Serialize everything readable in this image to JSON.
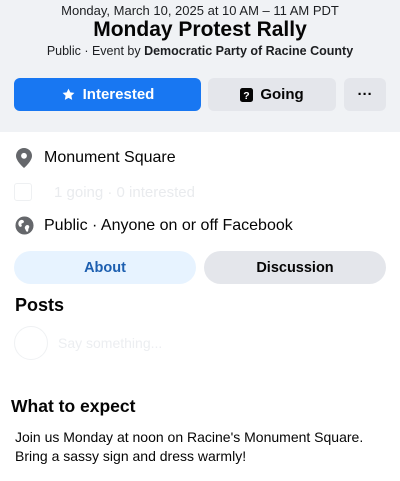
{
  "event": {
    "date_line": "Monday, March 10, 2025 at 10 AM – 11 AM PDT",
    "title": "Monday Protest Rally",
    "subtitle_prefix": "Public · Event by ",
    "organizer": "Democratic Party of Racine County"
  },
  "actions": {
    "interested_label": "Interested",
    "going_label": "Going",
    "more_label": "···",
    "interested_icon": "star-icon",
    "going_icon": "question-icon",
    "accent_color": "#1877f2"
  },
  "details": {
    "location": "Monument Square",
    "location_icon": "location-pin-icon",
    "faded_row": "1 going · 0 interested",
    "privacy": "Public · Anyone on or off Facebook",
    "privacy_icon": "globe-icon"
  },
  "tabs": [
    {
      "label": "About",
      "selected": true
    },
    {
      "label": "Discussion",
      "selected": false
    }
  ],
  "posts": {
    "heading": "Posts",
    "composer_placeholder": "Say something..."
  },
  "about": {
    "heading": "What to expect",
    "body": "Join us Monday at noon on Racine's Monument Square. Bring a sassy sign and dress warmly!"
  }
}
